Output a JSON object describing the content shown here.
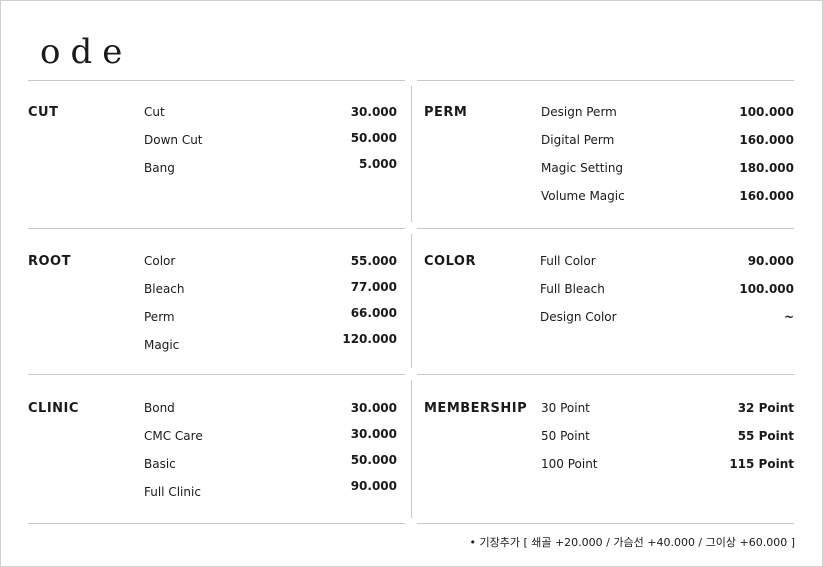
{
  "brand": "ode",
  "sections": {
    "cut": {
      "title": "CUT",
      "items": [
        {
          "name": "Cut",
          "price": "30.000"
        },
        {
          "name": "Down Cut",
          "price": "50.000"
        },
        {
          "name": "Bang",
          "price": "5.000"
        }
      ]
    },
    "perm": {
      "title": "PERM",
      "items": [
        {
          "name": "Design Perm",
          "price": "100.000"
        },
        {
          "name": "Digital Perm",
          "price": "160.000"
        },
        {
          "name": "Magic Setting",
          "price": "180.000"
        },
        {
          "name": "Volume Magic",
          "price": "160.000"
        }
      ]
    },
    "root": {
      "title": "ROOT",
      "items": [
        {
          "name": "Color",
          "price": "55.000"
        },
        {
          "name": "Bleach",
          "price": "77.000"
        },
        {
          "name": "Perm",
          "price": "66.000"
        },
        {
          "name": "Magic",
          "price": "120.000"
        }
      ]
    },
    "color": {
      "title": "COLOR",
      "items": [
        {
          "name": "Full Color",
          "price": "90.000"
        },
        {
          "name": "Full Bleach",
          "price": "100.000"
        },
        {
          "name": "Design Color",
          "price": "~"
        }
      ]
    },
    "clinic": {
      "title": "CLINIC",
      "items": [
        {
          "name": "Bond",
          "price": "30.000"
        },
        {
          "name": "CMC Care",
          "price": "30.000"
        },
        {
          "name": "Basic",
          "price": "50.000"
        },
        {
          "name": "Full Clinic",
          "price": "90.000"
        }
      ]
    },
    "membership": {
      "title": "MEMBERSHIP",
      "items": [
        {
          "name": "30 Point",
          "price": "32 Point"
        },
        {
          "name": "50 Point",
          "price": "55 Point"
        },
        {
          "name": "100 Point",
          "price": "115 Point"
        }
      ]
    }
  },
  "footer_note": "• 기장추가 [ 쇄골 +20.000 / 가슴선 +40.000 / 그이상 +60.000 ]"
}
